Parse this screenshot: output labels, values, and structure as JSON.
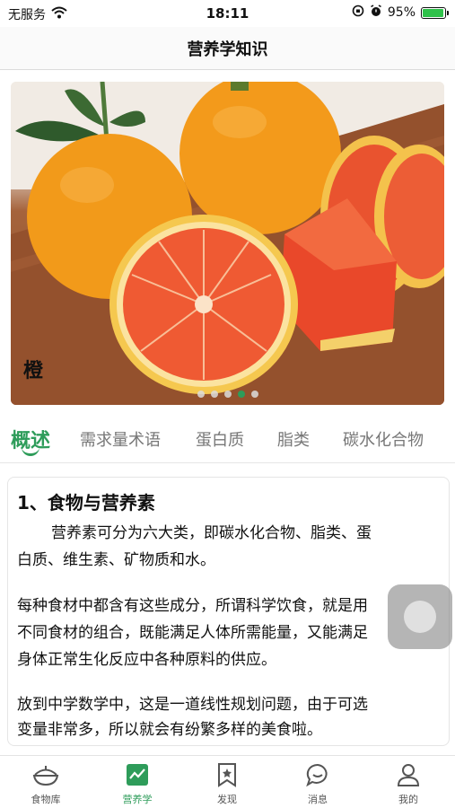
{
  "status_bar": {
    "carrier": "无服务",
    "time": "18:11",
    "battery_percent": "95%",
    "battery_level": 0.95
  },
  "nav": {
    "title": "营养学知识"
  },
  "banner": {
    "caption": "橙",
    "slide_count": 5,
    "active_slide": 3
  },
  "tabs": [
    {
      "label": "概述",
      "active": true
    },
    {
      "label": "需求量术语",
      "active": false
    },
    {
      "label": "蛋白质",
      "active": false
    },
    {
      "label": "脂类",
      "active": false
    },
    {
      "label": "碳水化合物",
      "active": false
    }
  ],
  "article": {
    "title": "1、食物与营养素",
    "lines": [
      "营养素可分为六大类，即碳水化合物、脂类、蛋",
      "白质、维生素、矿物质和水。",
      "每种食材中都含有这些成分，所谓科学饮食，就是用",
      "不同食材的组合，既能满足人体所需能量，又能满足",
      "身体正常生化反应中各种原料的供应。",
      "放到中学数学中，这是一道线性规划问题，由于可选",
      "变量非常多，所以就会有纷繁多样的美食啦。"
    ]
  },
  "tabbar": [
    {
      "label": "食物库",
      "icon": "food-bowl-icon",
      "active": false
    },
    {
      "label": "营养学",
      "icon": "chart-icon",
      "active": true
    },
    {
      "label": "发现",
      "icon": "bookmark-star-icon",
      "active": false
    },
    {
      "label": "消息",
      "icon": "chat-bubble-icon",
      "active": false
    },
    {
      "label": "我的",
      "icon": "person-icon",
      "active": false
    }
  ],
  "colors": {
    "accent": "#2e9c5a",
    "battery": "#2fc24a"
  }
}
